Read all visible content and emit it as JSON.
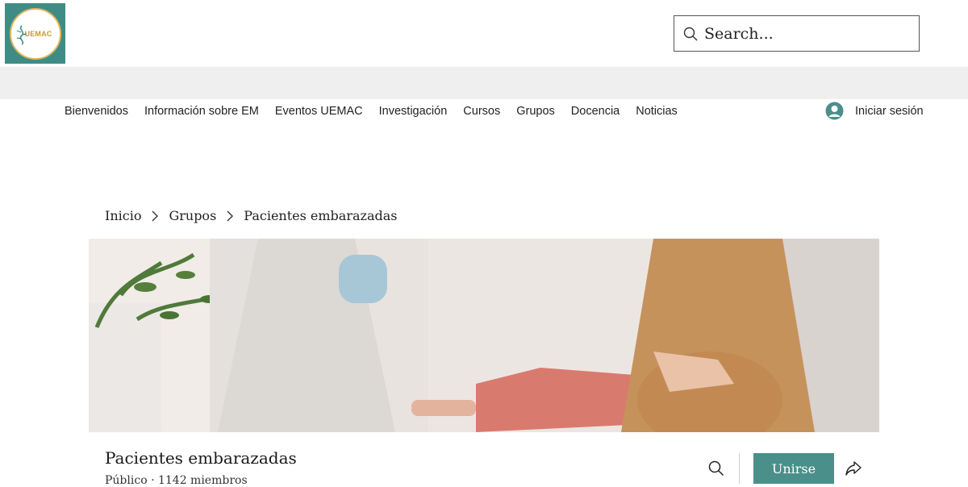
{
  "header": {
    "logo_text": "UEMAC",
    "search": {
      "placeholder": "Search..."
    }
  },
  "nav": {
    "items": [
      {
        "label": "Bienvenidos"
      },
      {
        "label": "Información sobre EM"
      },
      {
        "label": "Eventos UEMAC"
      },
      {
        "label": "Investigación"
      },
      {
        "label": "Cursos"
      },
      {
        "label": "Grupos"
      },
      {
        "label": "Docencia"
      },
      {
        "label": "Noticias"
      }
    ],
    "login_label": "Iniciar sesión"
  },
  "breadcrumb": {
    "items": [
      "Inicio",
      "Grupos",
      "Pacientes embarazadas"
    ]
  },
  "group": {
    "title": "Pacientes embarazadas",
    "meta": "Público · 1142 miembros",
    "join_label": "Unirse"
  },
  "colors": {
    "accent": "#4a8f8a",
    "logo_bg": "#3f8c86",
    "logo_gold": "#c99a2a",
    "band_gray": "#efefef"
  },
  "icons": {
    "search": "search-icon",
    "user": "user-avatar-icon",
    "chevron": "chevron-right-icon",
    "share": "share-icon"
  }
}
